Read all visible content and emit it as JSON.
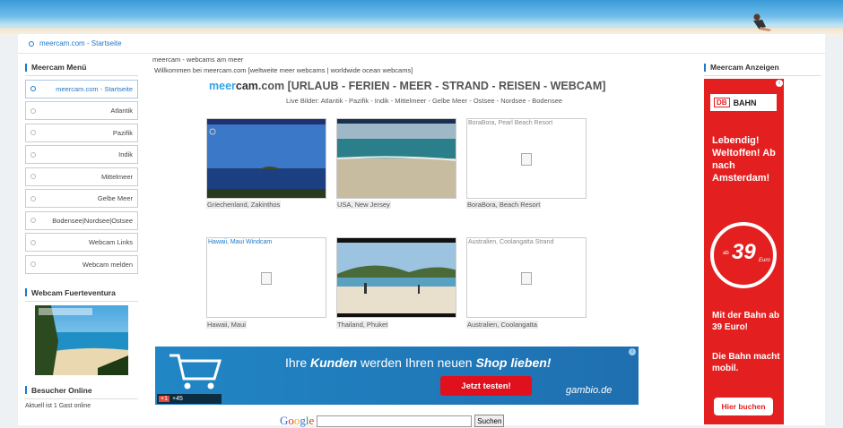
{
  "breadcrumb": "meercam.com - Startseite",
  "left": {
    "menu_title": "Meercam Menü",
    "menu": [
      {
        "label": "meercam.com - Startseite",
        "active": true
      },
      {
        "label": "Atlantik"
      },
      {
        "label": "Pazifik"
      },
      {
        "label": "Indik"
      },
      {
        "label": "Mittelmeer"
      },
      {
        "label": "Gelbe Meer"
      },
      {
        "label": "Bodensee|Nordsee|Ostsee"
      },
      {
        "label": "Webcam Links"
      },
      {
        "label": "Webcam melden"
      }
    ],
    "fuerte_title": "Webcam Fuerteventura",
    "visitors_title": "Besucher Online",
    "visitors_text": "Aktuell ist 1 Gast online"
  },
  "main": {
    "line1": "meercam - webcams am meer",
    "line2": "Willkommen bei meercam.com [weltweite meer webcams | worldwide ocean webcams]",
    "headline_meer": "meer",
    "headline_cam": "cam",
    "headline_rest": ".com [URLAUB - FERIEN - MEER - STRAND - REISEN - WEBCAM]",
    "subline": "Live Bilder: Atlantik - Pazifik - Indik - Mittelmeer - Gelbe Meer - Ostsee - Nordsee - Bodensee",
    "cams": [
      {
        "caption": "Griechenland, Zakinthos"
      },
      {
        "caption": "USA, New Jersey"
      },
      {
        "caption": "BoraBora, Beach Resort",
        "alt": "BoraBora, Pearl Beach Resort"
      },
      {
        "caption": "Hawaii, Maui",
        "alt": "Hawaii, Maui Windcam"
      },
      {
        "caption": "Thailand, Phuket"
      },
      {
        "caption": "Australien, Coolangatta",
        "alt": "Australien, Coolangatta Strand"
      }
    ]
  },
  "bottom_ad": {
    "msg_pre": "Ihre ",
    "msg_kunden": "Kunden",
    "msg_mid": " werden Ihren neuen ",
    "msg_shop": "Shop lieben!",
    "cta": "Jetzt testen!",
    "brand": "gambio.de",
    "gplus": "+1",
    "gplus_count": "+45"
  },
  "search": {
    "logo": "Google",
    "button": "Suchen",
    "value": ""
  },
  "right": {
    "title": "Meercam Anzeigen",
    "db": {
      "logo_db": "DB",
      "logo_bahn": "BAHN",
      "text1": "Lebendig! Weltoffen! Ab nach Amsterdam!",
      "ab": "ab",
      "price": "39",
      "euro": "Euro",
      "text2": "Mit der Bahn ab 39 Euro!",
      "text3": "Die Bahn macht mobil.",
      "button": "Hier buchen"
    }
  }
}
